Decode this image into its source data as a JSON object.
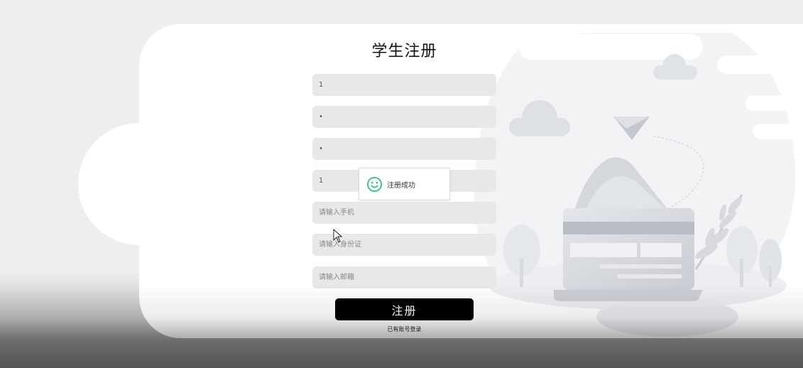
{
  "form": {
    "title": "学生注册",
    "fields": {
      "username": {
        "value": "1",
        "placeholder": ""
      },
      "password": {
        "value": "•",
        "placeholder": ""
      },
      "confirm_password": {
        "value": "•",
        "placeholder": ""
      },
      "name": {
        "value": "1",
        "placeholder": ""
      },
      "phone": {
        "value": "",
        "placeholder": "请输入手机"
      },
      "id_card": {
        "value": "",
        "placeholder": "请输入身份证"
      },
      "email": {
        "value": "",
        "placeholder": "请输入邮箱"
      }
    },
    "submit_label": "注册",
    "login_link": "已有账号登录"
  },
  "toast": {
    "message": "注册成功",
    "icon": "smile-icon",
    "color": "#3dbf8f"
  },
  "colors": {
    "background": "#efeff0",
    "card": "#ffffff",
    "field": "#e8e8e8",
    "button": "#000000"
  }
}
